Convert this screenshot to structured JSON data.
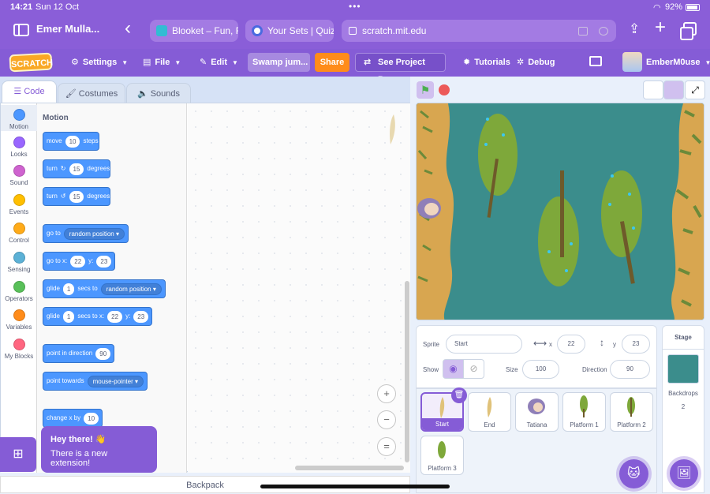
{
  "status": {
    "time": "14:21",
    "date": "Sun 12 Oct",
    "battery": "92%"
  },
  "browser": {
    "profile": "Emer Mulla...",
    "tab1": "Blooket – Fun, F",
    "tab2": "Your Sets | Quiz",
    "url": "scratch.mit.edu"
  },
  "menu": {
    "logo": "SCRATCH",
    "settings": "Settings",
    "file": "File",
    "edit": "Edit",
    "project_name": "Swamp jum...",
    "share": "Share",
    "see_project": "See Project Page",
    "tutorials": "Tutorials",
    "debug": "Debug",
    "username": "EmberM0use"
  },
  "editor_tabs": {
    "code": "Code",
    "costumes": "Costumes",
    "sounds": "Sounds"
  },
  "categories": [
    {
      "label": "Motion",
      "color": "#4c97ff"
    },
    {
      "label": "Looks",
      "color": "#9966ff"
    },
    {
      "label": "Sound",
      "color": "#cf63cf"
    },
    {
      "label": "Events",
      "color": "#ffbf00"
    },
    {
      "label": "Control",
      "color": "#ffab19"
    },
    {
      "label": "Sensing",
      "color": "#5cb1d6"
    },
    {
      "label": "Operators",
      "color": "#59c059"
    },
    {
      "label": "Variables",
      "color": "#ff8c1a"
    },
    {
      "label": "My Blocks",
      "color": "#ff6680"
    }
  ],
  "palette": {
    "heading": "Motion",
    "move": {
      "a": "move",
      "n": "10",
      "b": "steps"
    },
    "turn_right": {
      "a": "turn",
      "n": "15",
      "b": "degrees"
    },
    "turn_left": {
      "a": "turn",
      "n": "15",
      "b": "degrees"
    },
    "goto": {
      "a": "go to",
      "opt": "random position"
    },
    "gotoxy": {
      "a": "go to x:",
      "x": "22",
      "b": "y:",
      "y": "23"
    },
    "glide_to": {
      "a": "glide",
      "n": "1",
      "b": "secs to",
      "opt": "random position"
    },
    "glide_xy": {
      "a": "glide",
      "n": "1",
      "b": "secs to x:",
      "x": "22",
      "c": "y:",
      "y": "23"
    },
    "point_dir": {
      "a": "point in direction",
      "n": "90"
    },
    "point_towards": {
      "a": "point towards",
      "opt": "mouse-pointer"
    },
    "change_x": {
      "a": "change x by",
      "n": "10"
    }
  },
  "toast": {
    "title": "Hey there! 👋",
    "body": "There is a new extension!"
  },
  "backpack": "Backpack",
  "sprite_info": {
    "sprite_label": "Sprite",
    "sprite_name": "Start",
    "x_label": "x",
    "x": "22",
    "y_label": "y",
    "y": "23",
    "show_label": "Show",
    "size_label": "Size",
    "size": "100",
    "direction_label": "Direction",
    "direction": "90"
  },
  "sprites": [
    "Start",
    "End",
    "Tatiana",
    "Platform 1",
    "Platform 2",
    "Platform 3"
  ],
  "stage_panel": {
    "title": "Stage",
    "backdrops_label": "Backdrops",
    "backdrops_count": "2"
  }
}
